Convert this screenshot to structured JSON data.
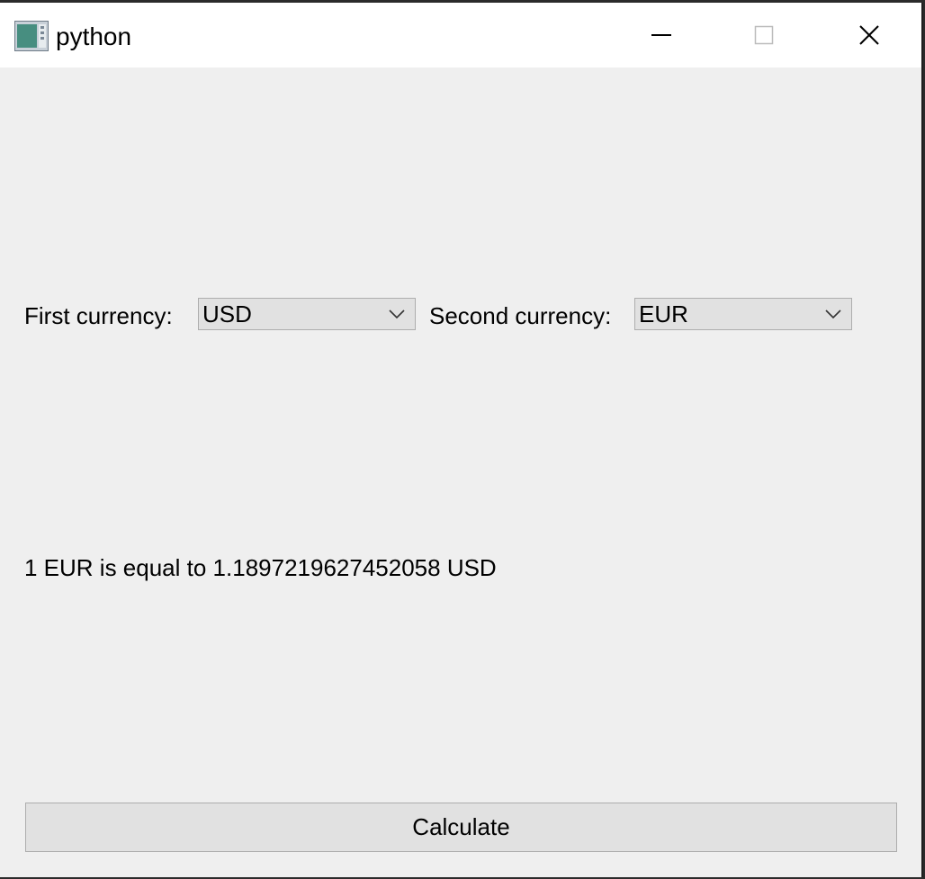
{
  "window": {
    "title": "python"
  },
  "titlebar_buttons": {
    "minimize_icon": "minimize-icon",
    "maximize_icon": "maximize-icon",
    "close_icon": "close-icon"
  },
  "form": {
    "first_currency_label": "First currency:",
    "first_currency_value": "USD",
    "second_currency_label": "Second currency:",
    "second_currency_value": "EUR"
  },
  "result": {
    "text": "1 EUR is equal to 1.1897219627452058 USD"
  },
  "actions": {
    "calculate_label": "Calculate"
  },
  "colors": {
    "window_bg": "#efefef",
    "titlebar_bg": "#ffffff",
    "control_bg": "#e1e1e1",
    "control_border": "#adadad"
  }
}
